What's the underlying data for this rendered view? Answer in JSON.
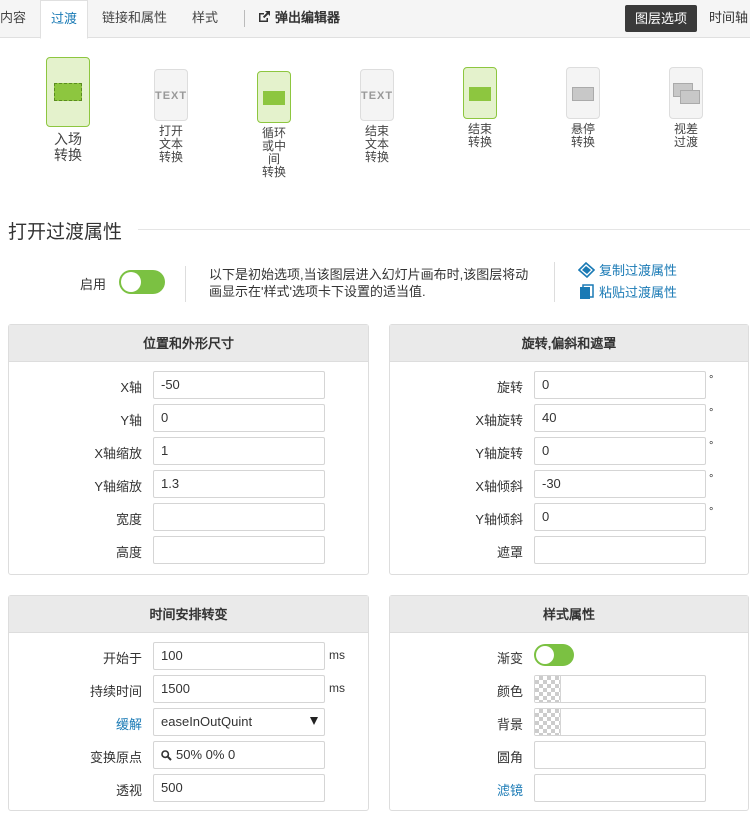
{
  "tabs": {
    "content": "内容",
    "transition": "过渡",
    "links": "链接和属性",
    "style": "样式",
    "popup_editor": "弹出编辑器",
    "layer_options": "图层选项",
    "timeline": "时间轴"
  },
  "transition_types": [
    {
      "label": "入场\n转换"
    },
    {
      "label": "打开\n文本\n转换",
      "glyph": "TEXT"
    },
    {
      "label": "循环\n或中\n间\n转换"
    },
    {
      "label": "结束\n文本\n转换",
      "glyph": "TEXT"
    },
    {
      "label": "结束\n转换"
    },
    {
      "label": "悬停\n转换"
    },
    {
      "label": "视差\n过渡"
    }
  ],
  "section": {
    "title": "打开过渡属性",
    "enable_label": "启用",
    "enabled": true,
    "info": "以下是初始选项,当该图层进入幻灯片画布时,该图层将动画显示在'样式'选项卡下设置的适当值.",
    "copy_link": "复制过渡属性",
    "paste_link": "粘贴过渡属性"
  },
  "position_panel": {
    "title": "位置和外形尺寸",
    "rows": [
      {
        "label": "X轴",
        "value": "-50"
      },
      {
        "label": "Y轴",
        "value": "0"
      },
      {
        "label": "X轴缩放",
        "value": "1"
      },
      {
        "label": "Y轴缩放",
        "value": "1.3"
      },
      {
        "label": "宽度",
        "value": ""
      },
      {
        "label": "高度",
        "value": ""
      }
    ]
  },
  "rotation_panel": {
    "title": "旋转,偏斜和遮罩",
    "degree_symbol": "°",
    "rows": [
      {
        "label": "旋转",
        "value": "0"
      },
      {
        "label": "X轴旋转",
        "value": "40"
      },
      {
        "label": "Y轴旋转",
        "value": "0"
      },
      {
        "label": "X轴倾斜",
        "value": "-30"
      },
      {
        "label": "Y轴倾斜",
        "value": "0"
      },
      {
        "label": "遮罩",
        "value": ""
      }
    ]
  },
  "timing_panel": {
    "title": "时间安排转变",
    "unit_ms": "ms",
    "rows": [
      {
        "label": "开始于",
        "value": "100"
      },
      {
        "label": "持续时间",
        "value": "1500"
      },
      {
        "label": "缓解",
        "value": "easeInOutQuint"
      },
      {
        "label": "变换原点",
        "value": "50% 0% 0"
      },
      {
        "label": "透视",
        "value": "500"
      }
    ]
  },
  "style_panel": {
    "title": "样式属性",
    "rows": [
      {
        "label": "渐变"
      },
      {
        "label": "颜色",
        "value": ""
      },
      {
        "label": "背景",
        "value": ""
      },
      {
        "label": "圆角",
        "value": ""
      },
      {
        "label": "滤镜",
        "value": ""
      }
    ]
  },
  "colors": {
    "accent_blue": "#1a7ab5",
    "toggle_green": "#7bc142",
    "icon_green": "#8dc63f"
  }
}
